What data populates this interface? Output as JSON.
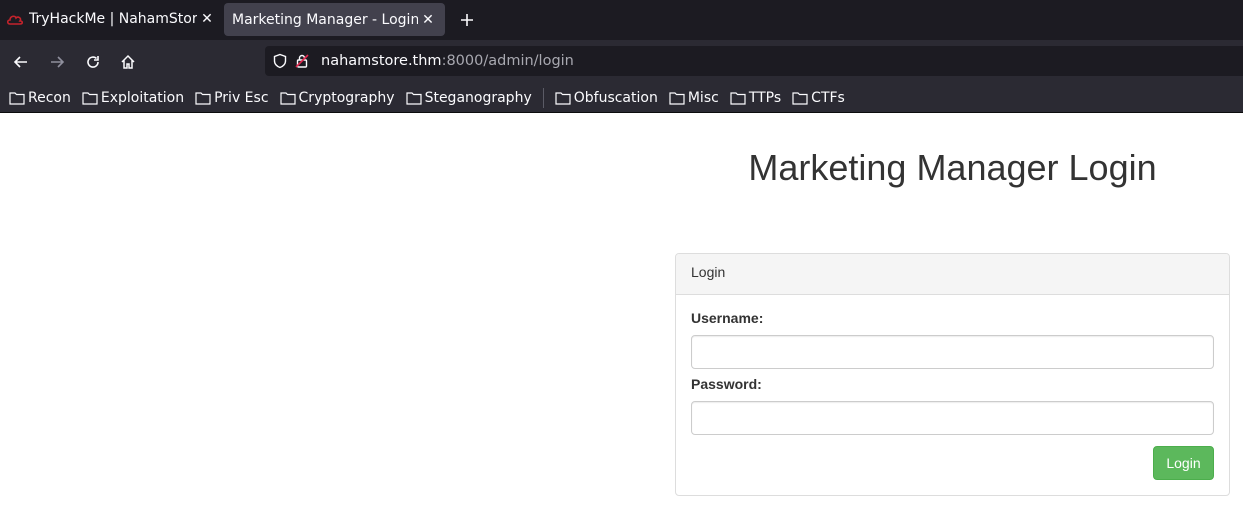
{
  "browser": {
    "tabs": [
      {
        "title": "TryHackMe | NahamStore",
        "favicon": "cloud-icon"
      },
      {
        "title": "Marketing Manager - Login",
        "active": true
      }
    ],
    "url": {
      "host": "nahamstore.thm",
      "rest": ":8000/admin/login"
    },
    "bookmarks": [
      "Recon",
      "Exploitation",
      "Priv Esc",
      "Cryptography",
      "Steganography",
      "Obfuscation",
      "Misc",
      "TTPs",
      "CTFs"
    ]
  },
  "page": {
    "title": "Marketing Manager Login",
    "panel_heading": "Login",
    "username_label": "Username:",
    "password_label": "Password:",
    "username_value": "",
    "password_value": "",
    "login_button": "Login"
  },
  "colors": {
    "tabbar_bg": "#1c1b22",
    "toolbar_bg": "#2b2a33",
    "active_tab_bg": "#42414d",
    "button_green": "#5cb85c",
    "favicon_red": "#c4232c"
  }
}
